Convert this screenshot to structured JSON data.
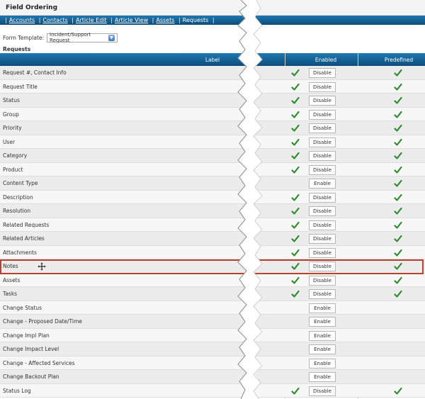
{
  "header": {
    "title": "Field Ordering"
  },
  "nav": {
    "links": [
      "Accounts",
      "Contacts",
      "Article Edit",
      "Article View",
      "Assets"
    ],
    "current": "Requests"
  },
  "form": {
    "template_label": "Form Template:",
    "template_value": "Incident/Support Request"
  },
  "section": {
    "title": "Requests"
  },
  "table": {
    "columns": {
      "label": "Label",
      "enabled": "Enabled",
      "predefined": "Predefined"
    },
    "rows": [
      {
        "label": "Request #, Contact Info",
        "enabled": true,
        "action": "Disable",
        "predefined": true
      },
      {
        "label": "Request Title",
        "enabled": true,
        "action": "Disable",
        "predefined": true
      },
      {
        "label": "Status",
        "enabled": true,
        "action": "Disable",
        "predefined": true
      },
      {
        "label": "Group",
        "enabled": true,
        "action": "Disable",
        "predefined": true
      },
      {
        "label": "Priority",
        "enabled": true,
        "action": "Disable",
        "predefined": true
      },
      {
        "label": "User",
        "enabled": true,
        "action": "Disable",
        "predefined": true
      },
      {
        "label": "Category",
        "enabled": true,
        "action": "Disable",
        "predefined": true
      },
      {
        "label": "Product",
        "enabled": true,
        "action": "Disable",
        "predefined": true
      },
      {
        "label": "Content Type",
        "enabled": false,
        "action": "Enable",
        "predefined": true
      },
      {
        "label": "Description",
        "enabled": true,
        "action": "Disable",
        "predefined": true
      },
      {
        "label": "Resolution",
        "enabled": true,
        "action": "Disable",
        "predefined": true
      },
      {
        "label": "Related Requests",
        "enabled": true,
        "action": "Disable",
        "predefined": true
      },
      {
        "label": "Related Articles",
        "enabled": true,
        "action": "Disable",
        "predefined": true
      },
      {
        "label": "Attachments",
        "enabled": true,
        "action": "Disable",
        "predefined": true
      },
      {
        "label": "Notes",
        "enabled": true,
        "action": "Disable",
        "predefined": true
      },
      {
        "label": "Assets",
        "enabled": true,
        "action": "Disable",
        "predefined": true
      },
      {
        "label": "Tasks",
        "enabled": true,
        "action": "Disable",
        "predefined": true
      },
      {
        "label": "Change Status",
        "enabled": false,
        "action": "Enable",
        "predefined": false
      },
      {
        "label": "Change - Proposed Date/Time",
        "enabled": false,
        "action": "Enable",
        "predefined": false
      },
      {
        "label": "Change Impl Plan",
        "enabled": false,
        "action": "Enable",
        "predefined": false
      },
      {
        "label": "Change Impact Level",
        "enabled": false,
        "action": "Enable",
        "predefined": false
      },
      {
        "label": "Change - Affected Services",
        "enabled": false,
        "action": "Enable",
        "predefined": false
      },
      {
        "label": "Change Backout Plan",
        "enabled": false,
        "action": "Enable",
        "predefined": false
      },
      {
        "label": "Status Log",
        "enabled": true,
        "action": "Disable",
        "predefined": true
      }
    ],
    "dragging_row": "Notes"
  },
  "colors": {
    "header_blue": "#1f78b1",
    "check_green": "#2e8b2e",
    "highlight": "#b5422a"
  }
}
